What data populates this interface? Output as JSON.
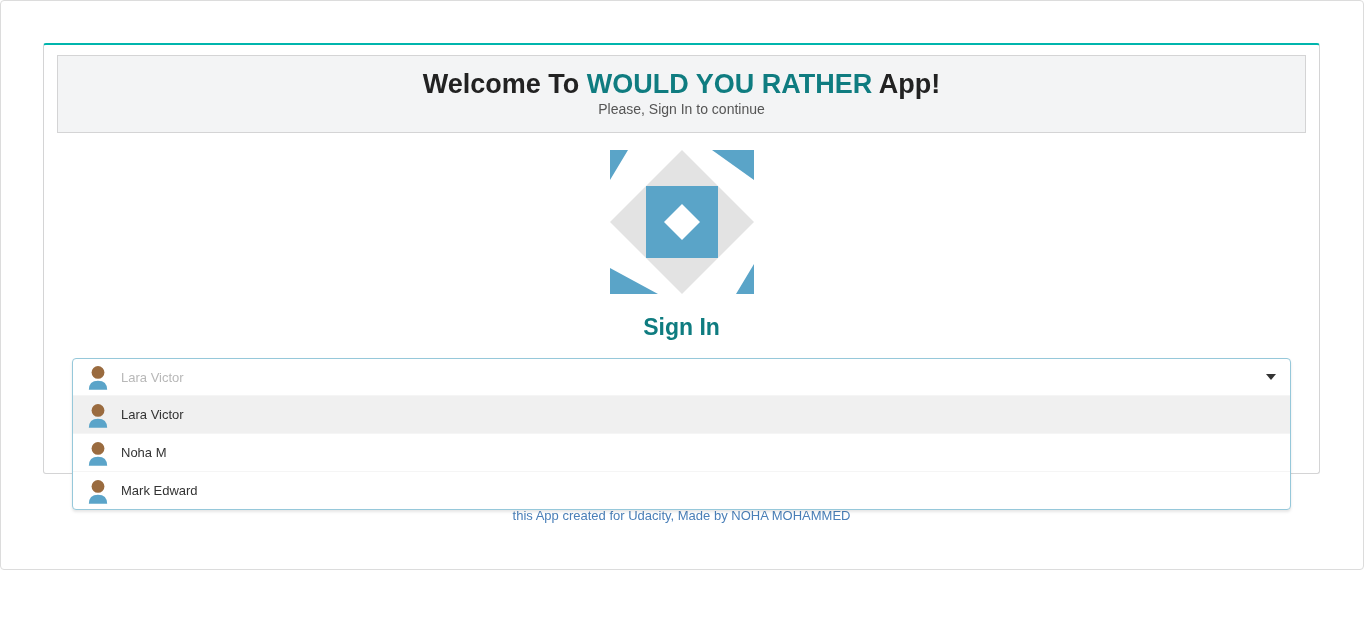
{
  "header": {
    "title_parts": [
      {
        "text": "Welcome To ",
        "accent": false
      },
      {
        "text": "WOULD YOU RATHER",
        "accent": true
      },
      {
        "text": " App!",
        "accent": false
      }
    ],
    "subtitle": "Please, Sign In to continue"
  },
  "sign_in": {
    "heading": "Sign In",
    "user_select": {
      "value": "Lara Victor",
      "expanded": true,
      "options": [
        {
          "name": "Lara Victor",
          "selected": true
        },
        {
          "name": "Noha M",
          "selected": false
        },
        {
          "name": "Mark Edward",
          "selected": false
        }
      ]
    }
  },
  "footer": "this App created for Udacity, Made by NOHA MOHAMMED"
}
